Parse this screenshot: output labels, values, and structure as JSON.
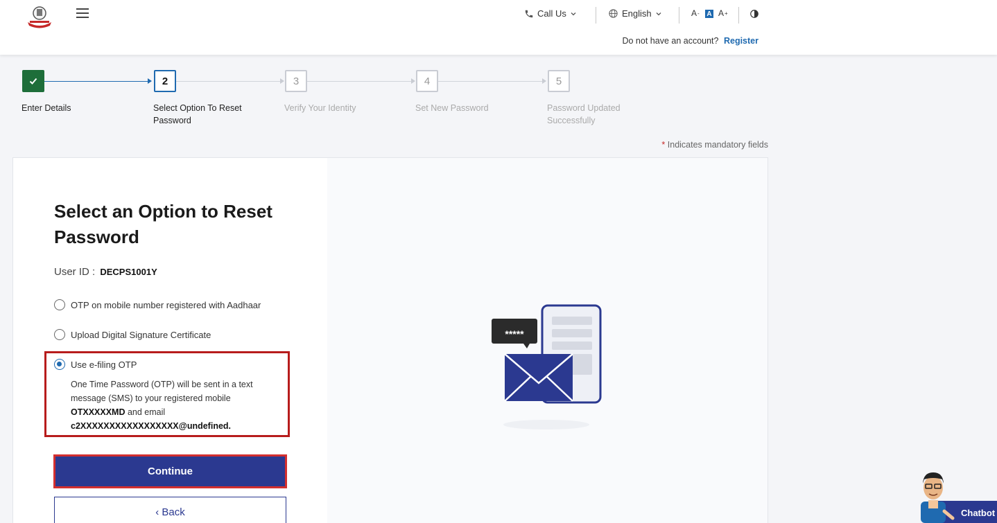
{
  "header": {
    "call_us": "Call Us",
    "language": "English",
    "font_decrease": "A",
    "font_default": "A",
    "font_increase": "A",
    "no_account_text": "Do not have an account?",
    "register_link": "Register"
  },
  "stepper": {
    "steps": [
      {
        "number": "",
        "label": "Enter Details",
        "state": "done"
      },
      {
        "number": "2",
        "label": "Select Option To Reset Password",
        "state": "active"
      },
      {
        "number": "3",
        "label": "Verify Your Identity",
        "state": "pending"
      },
      {
        "number": "4",
        "label": "Set New Password",
        "state": "pending"
      },
      {
        "number": "5",
        "label": "Password Updated Successfully",
        "state": "pending"
      }
    ]
  },
  "mandatory_note": {
    "star": "*",
    "text": "Indicates mandatory fields"
  },
  "form": {
    "title": "Select an Option to Reset Password",
    "user_id_label": "User ID :",
    "user_id_value": "DECPS1001Y",
    "options": [
      {
        "label": "OTP on mobile number registered with Aadhaar",
        "selected": false
      },
      {
        "label": "Upload Digital Signature Certificate",
        "selected": false
      },
      {
        "label": "Use e-filing OTP",
        "selected": true
      }
    ],
    "selected_desc_prefix": "One Time Password (OTP) will be sent in a text message (SMS) to your registered mobile ",
    "selected_mobile": "OTXXXXXMD",
    "selected_desc_middle": " and email ",
    "selected_email": "c2XXXXXXXXXXXXXXXXX@undefined.",
    "continue_button": "Continue",
    "back_button": "‹ Back"
  },
  "illustration": {
    "bubble_text": "*****"
  },
  "chatbot": {
    "label": "Chatbot"
  },
  "colors": {
    "primary": "#2b3990",
    "link": "#1f6ab0",
    "step_done": "#1e6e3a",
    "highlight": "#b71c1c"
  }
}
